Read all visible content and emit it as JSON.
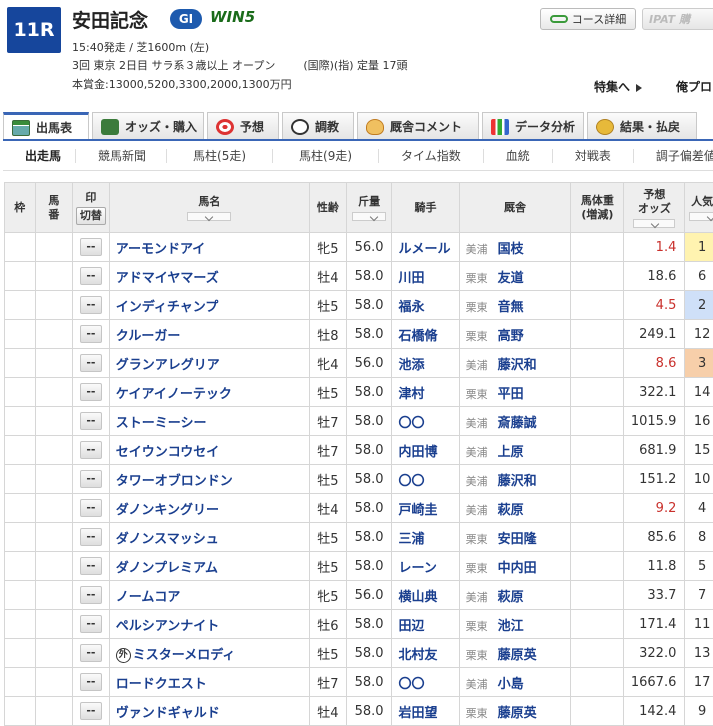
{
  "race": {
    "number": "11R",
    "title": "安田記念",
    "grade": "GI",
    "win5_prefix": "WIN",
    "win5_num": "5",
    "line1": "15:40発走 / 芝1600m (左)",
    "line2a": "3回 東京 2日目 サラ系３歳以上 オープン",
    "line2b": "(国際)(指) 定量 17頭",
    "line3": "本賞金:13000,5200,3300,2000,1300万円"
  },
  "header": {
    "course_button": "コース詳細",
    "ipat_button": "IPAT 購",
    "tokushu": "特集へ",
    "ore": "俺プロ"
  },
  "tabs": [
    {
      "label": "出馬表",
      "icon": "table-icon"
    },
    {
      "label": "オッズ・購入",
      "icon": "odds-icon"
    },
    {
      "label": "予想",
      "icon": "target-icon"
    },
    {
      "label": "調教",
      "icon": "stopwatch-icon"
    },
    {
      "label": "厩舎コメント",
      "icon": "comment-icon"
    },
    {
      "label": "データ分析",
      "icon": "bar-chart-icon"
    },
    {
      "label": "結果・払戻",
      "icon": "coin-icon"
    }
  ],
  "subnav": [
    "出走馬",
    "競馬新聞",
    "馬柱(5走)",
    "馬柱(9走)",
    "タイム指数",
    "血統",
    "対戦表",
    "調子偏差値"
  ],
  "columns": {
    "waku": "枠",
    "umaban_1": "馬",
    "umaban_2": "番",
    "mark": "印",
    "mark_toggle": "切替",
    "name": "馬名",
    "sex": "性齢",
    "kin": "斤量",
    "jockey": "騎手",
    "stable": "厩舎",
    "weight_1": "馬体重",
    "weight_2": "(増減)",
    "odds_1": "予想",
    "odds_2": "オッズ",
    "pop": "人気"
  },
  "mark_placeholder": "--",
  "foreign_mark": "外",
  "horses": [
    {
      "name": "アーモンドアイ",
      "sex": "牝5",
      "kin": "56.0",
      "jockey": "ルメール",
      "region": "美浦",
      "trainer": "国枝",
      "odds": "1.4",
      "pop": "1",
      "hot": true
    },
    {
      "name": "アドマイヤマーズ",
      "sex": "牡4",
      "kin": "58.0",
      "jockey": "川田",
      "region": "栗東",
      "trainer": "友道",
      "odds": "18.6",
      "pop": "6",
      "hot": false
    },
    {
      "name": "インディチャンプ",
      "sex": "牡5",
      "kin": "58.0",
      "jockey": "福永",
      "region": "栗東",
      "trainer": "音無",
      "odds": "4.5",
      "pop": "2",
      "hot": true
    },
    {
      "name": "クルーガー",
      "sex": "牡8",
      "kin": "58.0",
      "jockey": "石橋脩",
      "region": "栗東",
      "trainer": "高野",
      "odds": "249.1",
      "pop": "12",
      "hot": false
    },
    {
      "name": "グランアレグリア",
      "sex": "牝4",
      "kin": "56.0",
      "jockey": "池添",
      "region": "美浦",
      "trainer": "藤沢和",
      "odds": "8.6",
      "pop": "3",
      "hot": true
    },
    {
      "name": "ケイアイノーテック",
      "sex": "牡5",
      "kin": "58.0",
      "jockey": "津村",
      "region": "栗東",
      "trainer": "平田",
      "odds": "322.1",
      "pop": "14",
      "hot": false
    },
    {
      "name": "ストーミーシー",
      "sex": "牡7",
      "kin": "58.0",
      "jockey": "〇〇",
      "region": "美浦",
      "trainer": "斎藤誠",
      "odds": "1015.9",
      "pop": "16",
      "hot": false
    },
    {
      "name": "セイウンコウセイ",
      "sex": "牡7",
      "kin": "58.0",
      "jockey": "内田博",
      "region": "美浦",
      "trainer": "上原",
      "odds": "681.9",
      "pop": "15",
      "hot": false
    },
    {
      "name": "タワーオブロンドン",
      "sex": "牡5",
      "kin": "58.0",
      "jockey": "〇〇",
      "region": "美浦",
      "trainer": "藤沢和",
      "odds": "151.2",
      "pop": "10",
      "hot": false
    },
    {
      "name": "ダノンキングリー",
      "sex": "牡4",
      "kin": "58.0",
      "jockey": "戸崎圭",
      "region": "美浦",
      "trainer": "萩原",
      "odds": "9.2",
      "pop": "4",
      "hot": true
    },
    {
      "name": "ダノンスマッシュ",
      "sex": "牡5",
      "kin": "58.0",
      "jockey": "三浦",
      "region": "栗東",
      "trainer": "安田隆",
      "odds": "85.6",
      "pop": "8",
      "hot": false
    },
    {
      "name": "ダノンプレミアム",
      "sex": "牡5",
      "kin": "58.0",
      "jockey": "レーン",
      "region": "栗東",
      "trainer": "中内田",
      "odds": "11.8",
      "pop": "5",
      "hot": false
    },
    {
      "name": "ノームコア",
      "sex": "牝5",
      "kin": "56.0",
      "jockey": "横山典",
      "region": "美浦",
      "trainer": "萩原",
      "odds": "33.7",
      "pop": "7",
      "hot": false
    },
    {
      "name": "ペルシアンナイト",
      "sex": "牡6",
      "kin": "58.0",
      "jockey": "田辺",
      "region": "栗東",
      "trainer": "池江",
      "odds": "171.4",
      "pop": "11",
      "hot": false
    },
    {
      "name": "ミスターメロディ",
      "sex": "牡5",
      "kin": "58.0",
      "jockey": "北村友",
      "region": "栗東",
      "trainer": "藤原英",
      "odds": "322.0",
      "pop": "13",
      "hot": false,
      "foreign": true
    },
    {
      "name": "ロードクエスト",
      "sex": "牡7",
      "kin": "58.0",
      "jockey": "〇〇",
      "region": "美浦",
      "trainer": "小島",
      "odds": "1667.6",
      "pop": "17",
      "hot": false
    },
    {
      "name": "ヴァンドギャルド",
      "sex": "牡4",
      "kin": "58.0",
      "jockey": "岩田望",
      "region": "栗東",
      "trainer": "藤原英",
      "odds": "142.4",
      "pop": "9",
      "hot": false
    }
  ]
}
